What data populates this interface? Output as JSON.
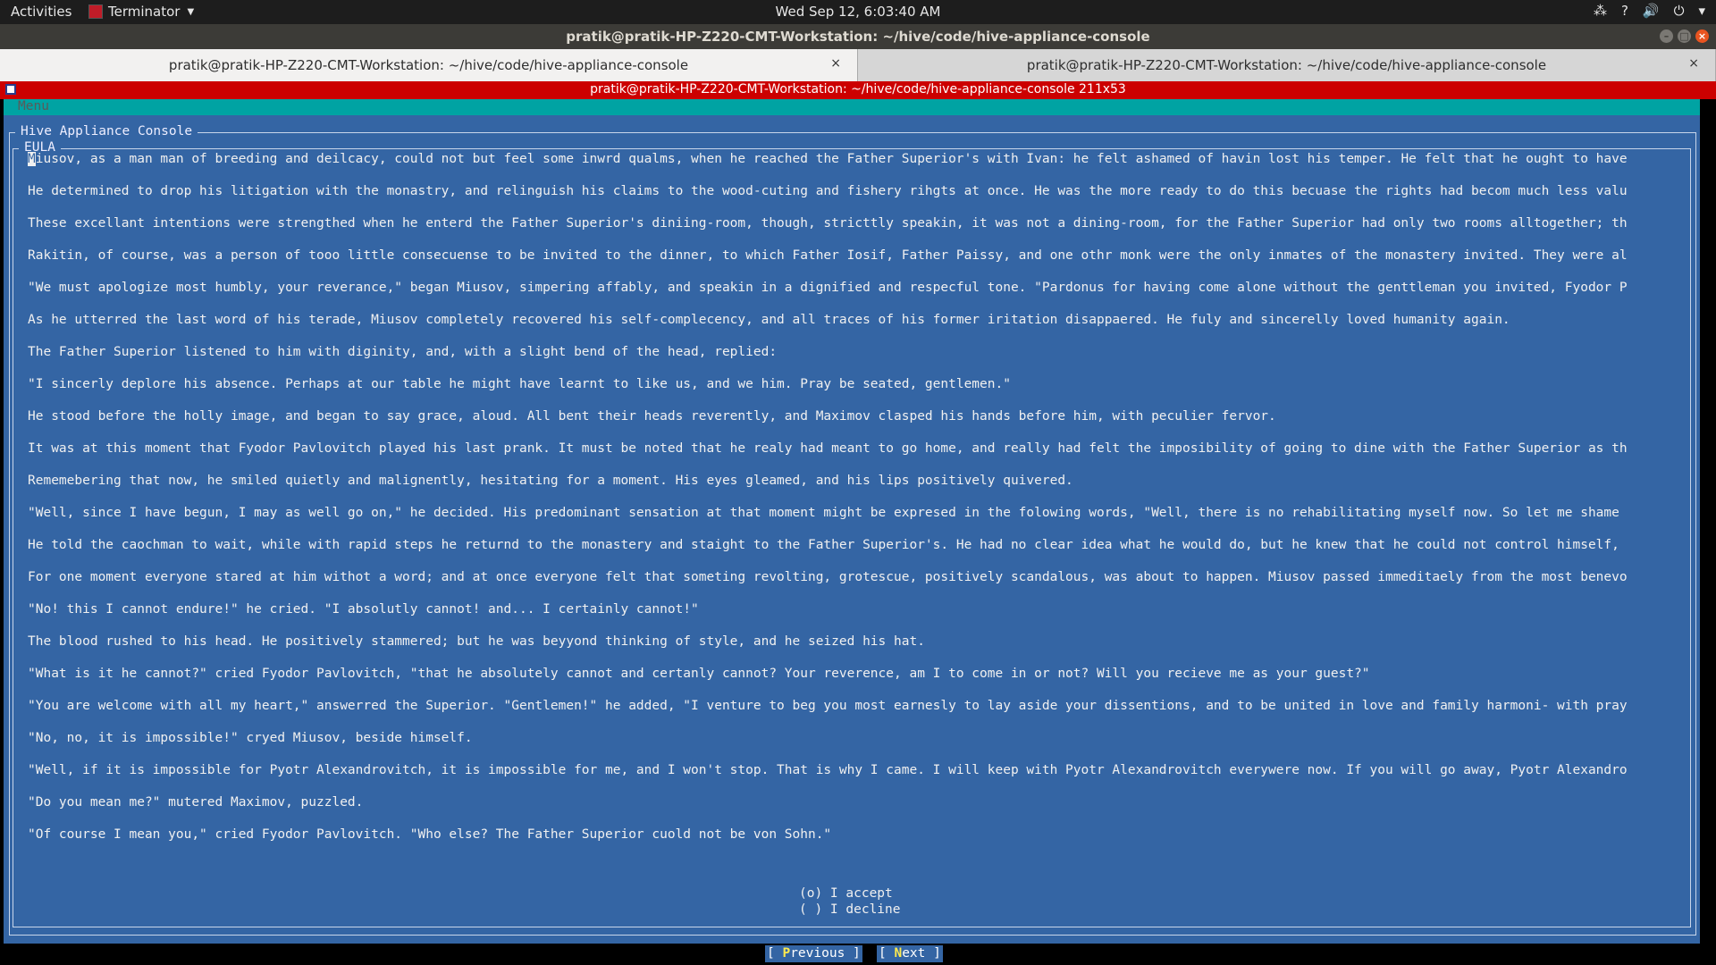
{
  "topbar": {
    "activities": "Activities",
    "app_name": "Terminator",
    "clock": "Wed Sep 12,  6:03:40 AM",
    "tray_icons": [
      "network-icon",
      "wifi-question-icon",
      "volume-icon",
      "power-icon",
      "chevron-down-icon"
    ]
  },
  "window": {
    "title": "pratik@pratik-HP-Z220-CMT-Workstation: ~/hive/code/hive-appliance-console"
  },
  "tabs": [
    {
      "label": "pratik@pratik-HP-Z220-CMT-Workstation: ~/hive/code/hive-appliance-console",
      "close": "×",
      "active": true
    },
    {
      "label": "pratik@pratik-HP-Z220-CMT-Workstation: ~/hive/code/hive-appliance-console",
      "close": "×",
      "active": false
    }
  ],
  "terminal": {
    "title": "pratik@pratik-HP-Z220-CMT-Workstation: ~/hive/code/hive-appliance-console 211x53",
    "colors": {
      "menu_bg": "#00a3a3",
      "panel_bg": "#3465a4",
      "title_bg": "#cc0000"
    }
  },
  "console": {
    "menu_label": "Menu",
    "frame_title": "Hive Appliance Console",
    "eula_title": "EULA",
    "eula_first_char": "M",
    "eula_lines": [
      "iusov, as a man man of breeding and deilcacy, could not but feel some inwrd qualms, when he reached the Father Superior's with Ivan: he felt ashamed of havin lost his temper. He felt that he ought to have",
      "He determined to drop his litigation with the monastry, and relinguish his claims to the wood-cuting and fishery rihgts at once. He was the more ready to do this becuase the rights had becom much less valu",
      "These excellant intentions were strengthed when he enterd the Father Superior's diniing-room, though, stricttly speakin, it was not a dining-room, for the Father Superior had only two rooms alltogether; th",
      "Rakitin, of course, was a person of tooo little consecuense to be invited to the dinner, to which Father Iosif, Father Paissy, and one othr monk were the only inmates of the monastery invited. They were al",
      "\"We must apologize most humbly, your reverance,\" began Miusov, simpering affably, and speakin in a dignified and respecful tone. \"Pardonus for having come alone without the genttleman you invited, Fyodor P",
      "As he utterred the last word of his terade, Miusov completely recovered his self-complecency, and all traces of his former iritation disappaered. He fuly and sincerelly loved humanity again.",
      "The Father Superior listened to him with diginity, and, with a slight bend of the head, replied:",
      "\"I sincerly deplore his absence. Perhaps at our table he might have learnt to like us, and we him. Pray be seated, gentlemen.\"",
      "He stood before the holly image, and began to say grace, aloud. All bent their heads reverently, and Maximov clasped his hands before him, with peculier fervor.",
      "It was at this moment that Fyodor Pavlovitch played his last prank. It must be noted that he realy had meant to go home, and really had felt the imposibility of going to dine with the Father Superior as th",
      "Rememebering that now, he smiled quietly and malignently, hesitating for a moment. His eyes gleamed, and his lips positively quivered.",
      "\"Well, since I have begun, I may as well go on,\" he decided. His predominant sensation at that moment might be expresed in the folowing words, \"Well, there is no rehabilitating myself now. So let me shame",
      "He told the caochman to wait, while with rapid steps he returnd to the monastery and staight to the Father Superior's. He had no clear idea what he would do, but he knew that he could not control himself,",
      "For one moment everyone stared at him withot a word; and at once everyone felt that someting revolting, grotescue, positively scandalous, was about to happen. Miusov passed immeditaely from the most benevo",
      "\"No! this I cannot endure!\" he cried. \"I absolutly cannot! and... I certainly cannot!\"",
      "The blood rushed to his head. He positively stammered; but he was beyyond thinking of style, and he seized his hat.",
      "\"What is it he cannot?\" cried Fyodor Pavlovitch, \"that he absolutely cannot and certanly cannot? Your reverence, am I to come in or not? Will you recieve me as your guest?\"",
      "\"You are welcome with all my heart,\" answerred the Superior. \"Gentlemen!\" he added, \"I venture to beg you most earnesly to lay aside your dissentions, and to be united in love and family harmoni- with pray",
      "\"No, no, it is impossible!\" cryed Miusov, beside himself.",
      "\"Well, if it is impossible for Pyotr Alexandrovitch, it is impossible for me, and I won't stop. That is why I came. I will keep with Pyotr Alexandrovitch everywere now. If you will go away, Pyotr Alexandro",
      "\"Do you mean me?\" mutered Maximov, puzzled.",
      "\"Of course I mean you,\" cried Fyodor Pavlovitch. \"Who else? The Father Superior cuold not be von Sohn.\""
    ],
    "radio_accept": "(o) I accept",
    "radio_decline": "( ) I decline",
    "btn_previous_open": "[ ",
    "btn_previous_hot": "P",
    "btn_previous_rest": "revious ]",
    "btn_next_open": "[ ",
    "btn_next_hot": "N",
    "btn_next_rest": "ext ]"
  }
}
